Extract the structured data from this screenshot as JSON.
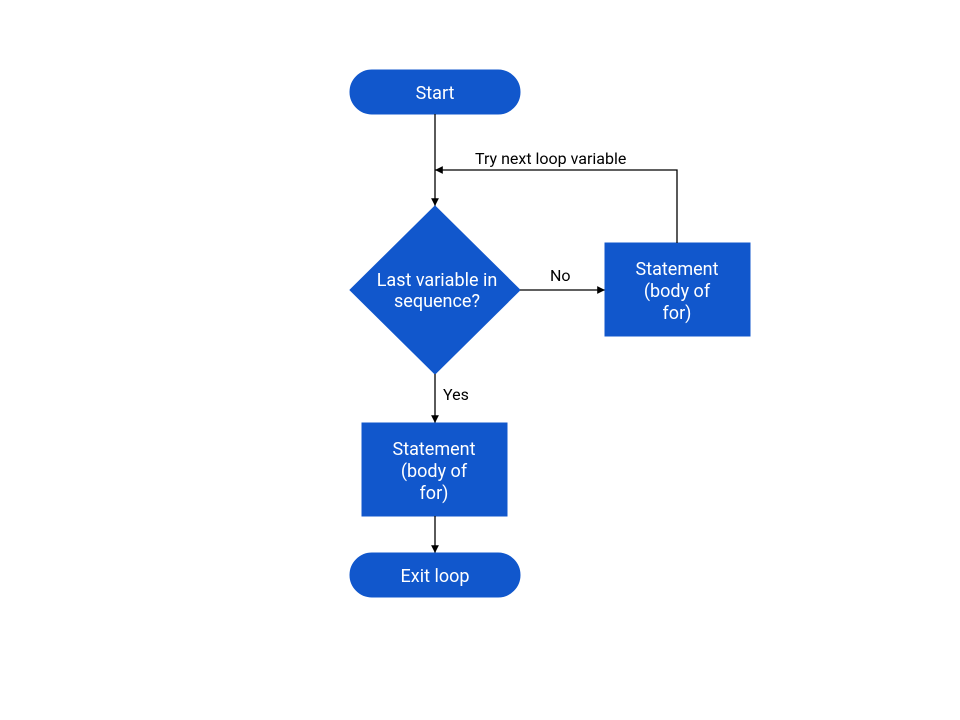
{
  "diagram": {
    "type": "flowchart",
    "color": "#1157cc",
    "nodes": {
      "start": {
        "shape": "terminator",
        "label": "Start"
      },
      "decision": {
        "shape": "diamond",
        "label_line1": "Last variable in",
        "label_line2": "sequence?"
      },
      "body_right": {
        "shape": "process",
        "label_line1": "Statement",
        "label_line2": "(body of",
        "label_line3": "for)"
      },
      "body_below": {
        "shape": "process",
        "label_line1": "Statement",
        "label_line2": "(body of",
        "label_line3": "for)"
      },
      "exit": {
        "shape": "terminator",
        "label": "Exit loop"
      }
    },
    "edges": {
      "no": "No",
      "yes": "Yes",
      "loopback": "Try next loop variable"
    }
  }
}
